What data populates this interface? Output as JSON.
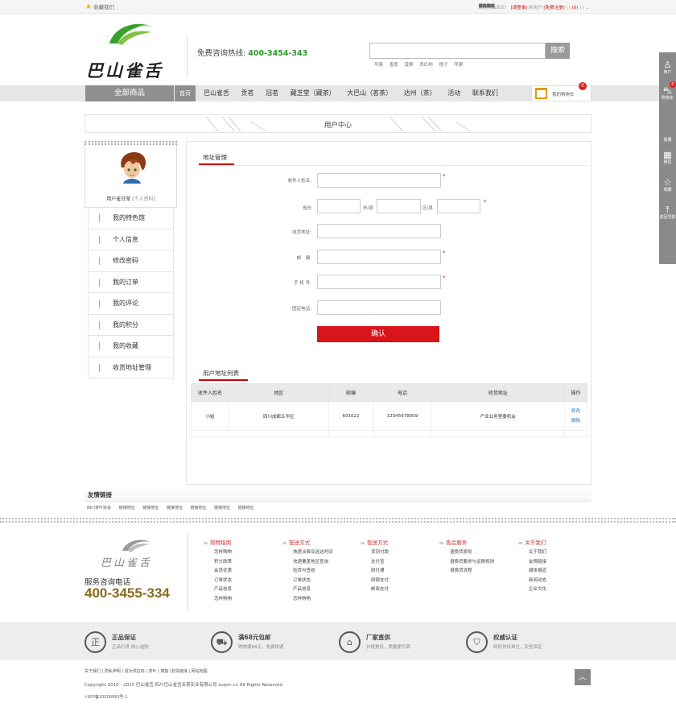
{
  "topbar": {
    "favorite_label": "收藏我们",
    "welcome": "欢迎光临本店！",
    "login": "[请登录]",
    "new_user": "新用户",
    "register": "[免费注册]",
    "my_orders": "我的订单",
    "cart_label": "购物车",
    "cart_count": "0",
    "contact": "联系我们",
    "service": "客户服务"
  },
  "header": {
    "logo_text": "巴山雀舌",
    "hotline_label": "免费咨询热线:",
    "hotline_number": "400-3454-343",
    "search_placeholder": "",
    "search_button": "搜索",
    "hot_words": [
      "苹果",
      "香蕉",
      "菠萝",
      "西红柿",
      "橙子",
      "苹果"
    ]
  },
  "nav": {
    "all_goods": "全部商品",
    "home": "首页",
    "items": [
      "巴山雀舌",
      "贡茗",
      "冠茗",
      "藏芝堂（藏茶）",
      "大巴山（茗茶）",
      "达州（茶）",
      "活动",
      "联系我们"
    ],
    "cart_text": "我的购物车",
    "cart_badge": "0"
  },
  "page": {
    "title": "用户中心"
  },
  "sidebar": {
    "username": "用户雀甘草",
    "profile_link": "[个人资料]",
    "menu": [
      "我的特色馆",
      "个人信息",
      "修改密码",
      "我的订单",
      "我的评论",
      "我的积分",
      "我的收藏",
      "收货地址管理"
    ]
  },
  "address_form": {
    "tab": "地址管理",
    "receiver_label": "收件人姓名:",
    "province_label": "省份",
    "city_label": "市/县",
    "district_label": "区/县",
    "address_label": "收货地址:",
    "postcode_label": "邮　编:",
    "mobile_label": "手 机 号:",
    "phone_label": "固定电话:",
    "required_mark": "*",
    "confirm_button": "确认"
  },
  "address_list": {
    "tab": "用户地址列表",
    "columns": [
      "收件人姓名",
      "地区",
      "邮编",
      "电话",
      "收货地址",
      "操作"
    ],
    "rows": [
      {
        "name": "小姐",
        "region": "四川成都五华区",
        "postcode": "601022",
        "phone": "12345678909",
        "address": "产业业务室委机会",
        "edit": "修改",
        "delete": "删除"
      }
    ]
  },
  "friends": {
    "title": "友情链接",
    "links": [
      "四川茶叶协会",
      "链接地址",
      "链接地址",
      "链接地址",
      "链接地址",
      "链接地址",
      "链接地址"
    ]
  },
  "footer": {
    "logo_text": "巴山雀舌",
    "service_label": "服务咨询电话",
    "service_phone": "400-3455-334",
    "columns": [
      {
        "title": "购物指南",
        "items": [
          "怎样购物",
          "积分政策",
          "会员优惠",
          "订单状态",
          "产品信息",
          "怎样购物"
        ]
      },
      {
        "title": "配送方式",
        "items": [
          "快递派费及送达时间",
          "快递覆盖地区查询",
          "验货与签收",
          "订单状态",
          "产品信息",
          "怎样购物"
        ]
      },
      {
        "title": "配送方式",
        "items": [
          "货到付款",
          "支付宝",
          "财付通",
          "网银支付",
          "邮政支付"
        ]
      },
      {
        "title": "售后服务",
        "items": [
          "退换货原则",
          "退换货要求与运费规则",
          "退换货流程"
        ]
      },
      {
        "title": "关于我们",
        "items": [
          "关于我们",
          "友情链接",
          "媒体报道",
          "新闻动态",
          "企业文化"
        ]
      }
    ],
    "guarantees": [
      {
        "icon": "正",
        "title": "正品保证",
        "sub": "正品行货 放心选购"
      },
      {
        "icon": "truck-icon",
        "title": "满68元包邮",
        "sub": "购物满68元，免费快递"
      },
      {
        "icon": "factory-icon",
        "title": "厂家直供",
        "sub": "价格更低，质量更可靠"
      },
      {
        "icon": "shield-icon",
        "title": "权威认证",
        "sub": "政府扶持单位，安全保证"
      }
    ],
    "bottom_links": "关于我们 | 隐私申明 | 成为供应商 | 茶叶 | 博客 |友情链接 | 网站地图",
    "copyright": "Copyright 2010 - 2015 巴山雀舌 四川巴山雀舌名茶实业有限公司 zuipin.cn All Rights Reserved",
    "icp": "川ICP备10200063号-1"
  },
  "dock": {
    "user": "用户",
    "cart": "购物车",
    "cart_count": "0",
    "service": "客服",
    "wechat": "微信",
    "favorite": "收藏",
    "top": "返回顶部"
  },
  "colors": {
    "accent_red": "#d9141a",
    "hotline_green": "#2d9b2b",
    "phone_gold": "#8b6a1c",
    "nav_gray": "#8f8f8f"
  }
}
